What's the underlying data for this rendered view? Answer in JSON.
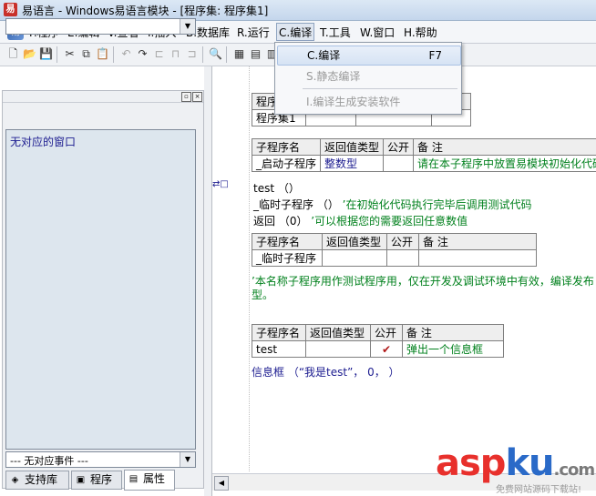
{
  "window": {
    "title": "易语言 - Windows易语言模块 - [程序集: 程序集1]"
  },
  "menubar": {
    "items": [
      "F.程序",
      "E.编辑",
      "V.查看",
      "I.插入",
      "B.数据库",
      "R.运行",
      "C.编译",
      "T.工具",
      "W.窗口",
      "H.帮助"
    ],
    "active": "C.编译"
  },
  "compile_menu": {
    "items": [
      {
        "label": "C.编译",
        "shortcut": "F7",
        "state": "highlighted"
      },
      {
        "label": "S.静态编译",
        "shortcut": "",
        "state": "disabled"
      },
      {
        "label": "I.编译生成安装软件",
        "shortcut": "",
        "state": "disabled"
      }
    ]
  },
  "left_panel": {
    "combo_top_value": "",
    "list_items": [
      "无对应的窗口"
    ],
    "combo_bottom_value": "--- 无对应事件 ---",
    "tabs": [
      "支持库",
      "程序",
      "属性"
    ],
    "active_tab": "属性"
  },
  "editor": {
    "assembly_table": {
      "header": "程序",
      "row": "程序集1"
    },
    "sub1_table": {
      "headers": [
        "子程序名",
        "返回值类型",
        "公开",
        "备 注"
      ],
      "row": {
        "name": "_启动子程序",
        "type": "整数型",
        "public": "",
        "note": "请在本子程序中放置易模块初始化代码"
      }
    },
    "sub1_code": [
      "test （）",
      "_临时子程序 （）",
      "’在初始化代码执行完毕后调用测试代码",
      "返回 （0）",
      "’可以根据您的需要返回任意数值"
    ],
    "sub2_table": {
      "headers": [
        "子程序名",
        "返回值类型",
        "公开",
        "备 注"
      ],
      "row": {
        "name": "_临时子程序",
        "type": "",
        "public": "",
        "note": ""
      }
    },
    "sub2_comment": [
      "’本名称子程序用作测试程序用，仅在开发及调试环境中有效，编译发布",
      "型。"
    ],
    "sub3_table": {
      "headers": [
        "子程序名",
        "返回值类型",
        "公开",
        "备 注"
      ],
      "row": {
        "name": "test",
        "type": "",
        "public": "✔",
        "note": "弹出一个信息框"
      }
    },
    "sub3_code": "信息框 （“我是test”， 0， ）"
  },
  "watermark": {
    "text_red": "asp",
    "text_blue": "ku",
    "suffix": ".com",
    "subtitle": "免费网站源码下载站!"
  },
  "colors": {
    "accent_menu_highlight": "#d6e3f4",
    "comment_green": "#00801c",
    "watermark_red": "#e8302c",
    "watermark_blue": "#2a6ac8"
  }
}
